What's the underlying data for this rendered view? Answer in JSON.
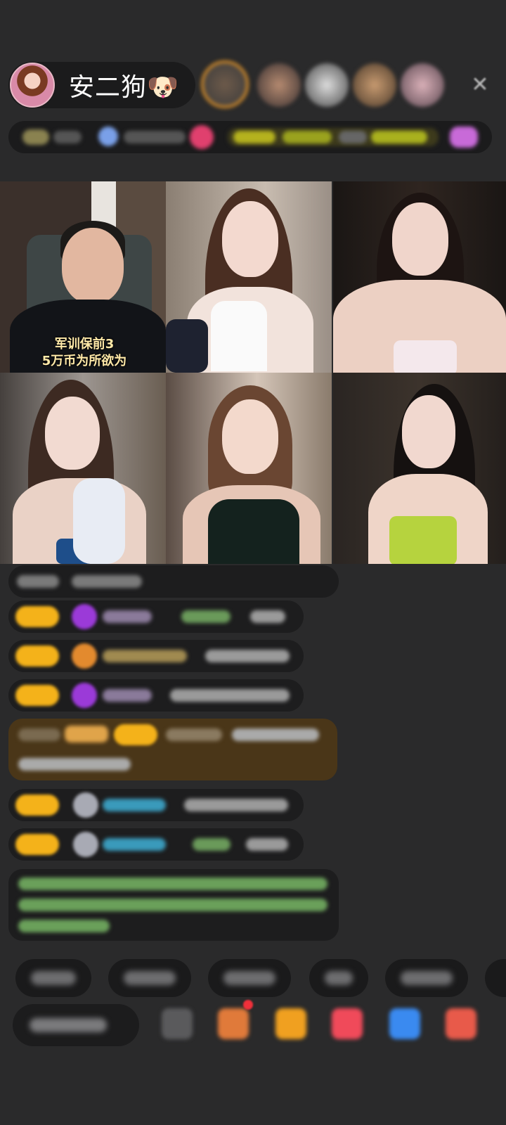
{
  "anchor": {
    "name": "安二狗",
    "name_emoji": "🐶"
  },
  "header": {
    "close_glyph": "✕"
  },
  "video_grid": {
    "tiles": [
      {
        "caption": "军训保前3\n5万币为所欲为"
      }
    ]
  },
  "colors": {
    "background": "#2a2a2b",
    "pill": "#1b1b1c",
    "badge_gold": "#f4b21a",
    "caption": "#ffe9a8"
  }
}
